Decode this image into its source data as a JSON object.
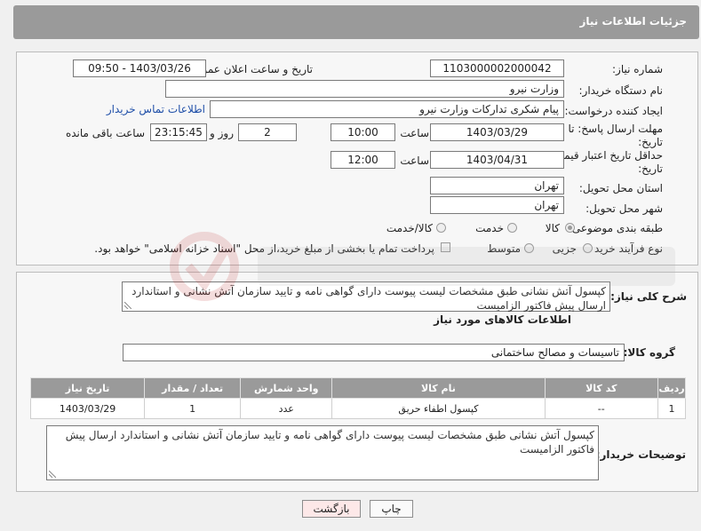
{
  "header": {
    "title": "جزئیات اطلاعات نیاز"
  },
  "need_number": {
    "label": "شماره نیاز:",
    "value": "1103000002000042"
  },
  "announce_datetime": {
    "label": "تاریخ و ساعت اعلان عمومی:",
    "value": "1403/03/26 - 09:50"
  },
  "buyer_org": {
    "label": "نام دستگاه خریدار:",
    "value": "وزارت نیرو"
  },
  "requester": {
    "label": "ایجاد کننده درخواست:",
    "value": "پیام شکری تدارکات وزارت نیرو",
    "contact_link": "اطلاعات تماس خریدار"
  },
  "reply_deadline": {
    "label_line1": "مهلت ارسال پاسخ: تا",
    "label_line2": "تاریخ:",
    "date": "1403/03/29",
    "time_label": "ساعت",
    "time": "10:00",
    "days": "2",
    "days_label": "روز و",
    "remaining": "23:15:45",
    "remaining_label": "ساعت باقی مانده"
  },
  "price_validity": {
    "label_line1": "حداقل تاریخ اعتبار قیمت: تا",
    "label_line2": "تاریخ:",
    "date": "1403/04/31",
    "time_label": "ساعت",
    "time": "12:00"
  },
  "delivery_province": {
    "label": "استان محل تحویل:",
    "value": "تهران"
  },
  "delivery_city": {
    "label": "شهر محل تحویل:",
    "value": "تهران"
  },
  "category": {
    "label": "طبقه بندی موضوعی:",
    "options": [
      "کالا",
      "خدمت",
      "کالا/خدمت"
    ],
    "selected": "کالا"
  },
  "purchase_process": {
    "label": "نوع فرآیند خرید :",
    "options": [
      "جزیی",
      "متوسط"
    ],
    "payment_note": "پرداخت تمام یا بخشی از مبلغ خرید،از محل \"اسناد خزانه اسلامی\" خواهد بود."
  },
  "general_description": {
    "label": "شرح کلی نیاز:",
    "value": "کپسول آتش نشانی طبق مشخصات لیست پیوست دارای گواهی نامه و تایید سازمان آتش نشانی و استاندارد ارسال پیش فاکتور الزامیست"
  },
  "items_section": {
    "title": "اطلاعات کالاهای مورد نیاز"
  },
  "goods_group": {
    "label": "گروه کالا:",
    "value": "تاسیسات و مصالح ساختمانی"
  },
  "items_table": {
    "headers": [
      "ردیف",
      "کد کالا",
      "نام کالا",
      "واحد شمارش",
      "تعداد / مقدار",
      "تاریخ نیاز"
    ],
    "rows": [
      [
        "1",
        "--",
        "کپسول اطفاء حریق",
        "عدد",
        "1",
        "1403/03/29"
      ]
    ]
  },
  "buyer_notes": {
    "label": "توضیحات خریدار:",
    "value": "کپسول آتش نشانی طبق مشخصات لیست پیوست دارای گواهی نامه و تایید سازمان آتش نشانی و استاندارد ارسال پیش فاکتور الزامیست"
  },
  "buttons": {
    "print": "چاپ",
    "back": "بازگشت"
  },
  "colors": {
    "header": "#9a9a9a",
    "link": "#1f4fa8",
    "back_button": "#fde8e8"
  }
}
